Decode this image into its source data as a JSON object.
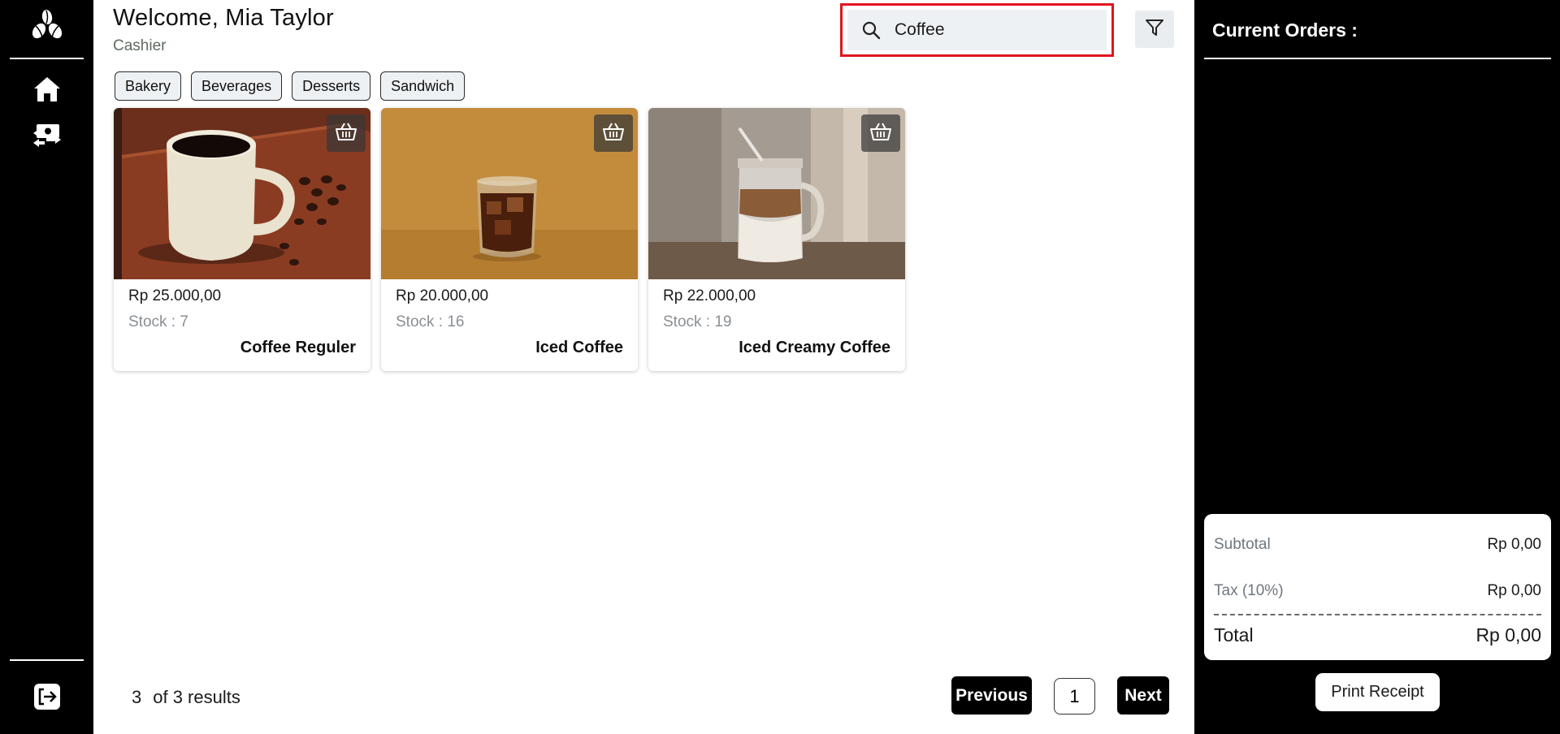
{
  "header": {
    "welcome": "Welcome, Mia Taylor",
    "role": "Cashier"
  },
  "search": {
    "value": "Coffee",
    "icon": "search-icon"
  },
  "filter": {
    "icon": "filter-icon"
  },
  "sidebar": {
    "logo": "coffee-beans-logo",
    "items": [
      {
        "icon": "home-icon"
      },
      {
        "icon": "money-transfer-icon"
      }
    ],
    "logout_icon": "logout-icon"
  },
  "categories": [
    "Bakery",
    "Beverages",
    "Desserts",
    "Sandwich"
  ],
  "products": [
    {
      "price": "Rp 25.000,00",
      "stock": "Stock : 7",
      "name": "Coffee Reguler"
    },
    {
      "price": "Rp 20.000,00",
      "stock": "Stock : 16",
      "name": "Iced Coffee"
    },
    {
      "price": "Rp 22.000,00",
      "stock": "Stock : 19",
      "name": "Iced Creamy Coffee"
    }
  ],
  "pagination": {
    "count": "3",
    "results_text": "of 3 results",
    "previous": "Previous",
    "page": "1",
    "next": "Next"
  },
  "orders": {
    "title": "Current Orders :",
    "subtotal_label": "Subtotal",
    "subtotal_value": "Rp 0,00",
    "tax_label": "Tax (10%)",
    "tax_value": "Rp 0,00",
    "total_label": "Total",
    "total_value": "Rp 0,00",
    "print_label": "Print Receipt"
  },
  "colors": {
    "sidebar_bg": "#000000",
    "search_highlight": "#e0141e",
    "search_bg": "#eef1f4",
    "chip_bg": "#eef1f4"
  }
}
